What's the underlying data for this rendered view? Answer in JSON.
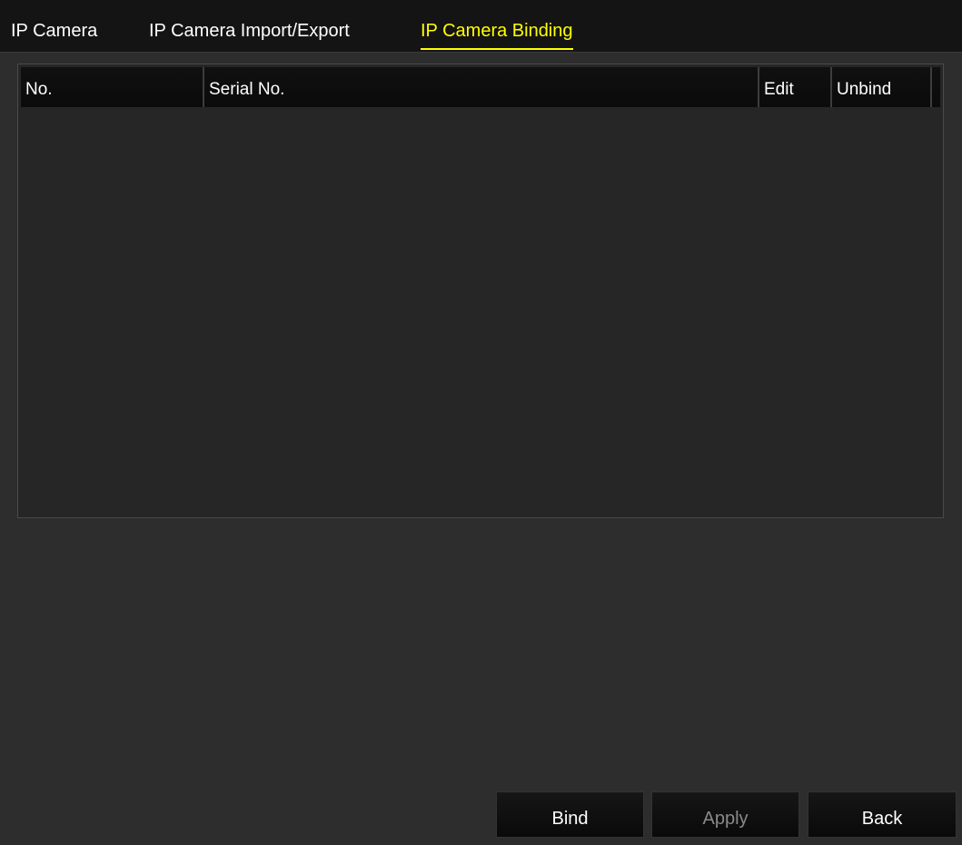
{
  "tabs": [
    {
      "label": "IP Camera"
    },
    {
      "label": "IP Camera Import/Export"
    },
    {
      "label": "IP Camera Binding"
    }
  ],
  "active_tab_color": "#ffff00",
  "table": {
    "columns": [
      "No.",
      "Serial No.",
      "Edit",
      "Unbind"
    ],
    "rows": []
  },
  "buttons": {
    "bind": "Bind",
    "apply": "Apply",
    "back": "Back"
  }
}
